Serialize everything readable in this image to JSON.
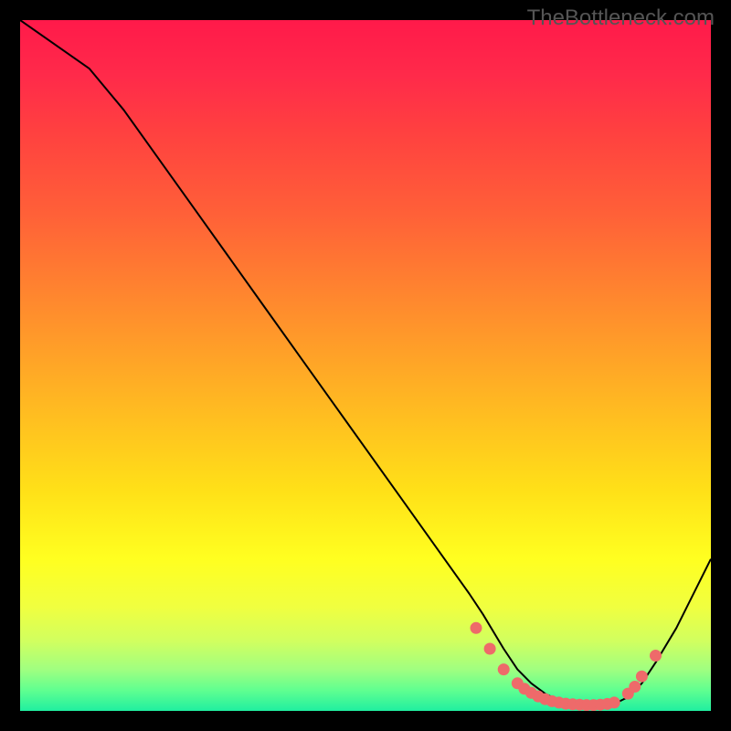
{
  "watermark": "TheBottleneck.com",
  "chart_data": {
    "type": "line",
    "title": "",
    "xlabel": "",
    "ylabel": "",
    "xlim": [
      0,
      100
    ],
    "ylim": [
      0,
      100
    ],
    "line": {
      "x": [
        0,
        10,
        15,
        20,
        25,
        30,
        35,
        40,
        45,
        50,
        55,
        60,
        65,
        67,
        70,
        72,
        74,
        76,
        78,
        80,
        82,
        84,
        86,
        88,
        90,
        92,
        95,
        100
      ],
      "y": [
        100,
        93,
        87,
        80,
        73,
        66,
        59,
        52,
        45,
        38,
        31,
        24,
        17,
        14,
        9,
        6,
        4,
        2.5,
        1.5,
        1,
        0.8,
        0.8,
        1,
        2,
        4,
        7,
        12,
        22
      ]
    },
    "markers": {
      "x": [
        66,
        68,
        70,
        72,
        73,
        74,
        75,
        76,
        77,
        78,
        79,
        80,
        81,
        82,
        83,
        84,
        85,
        86,
        88,
        89,
        90,
        92
      ],
      "y": [
        12,
        9,
        6,
        4,
        3.2,
        2.6,
        2.1,
        1.7,
        1.4,
        1.2,
        1.05,
        0.95,
        0.9,
        0.85,
        0.85,
        0.9,
        1.0,
        1.2,
        2.5,
        3.5,
        5,
        8
      ]
    },
    "colors": {
      "line": "#000000",
      "marker_fill": "#ee6a6a",
      "marker_stroke": "#ee6a6a"
    }
  }
}
